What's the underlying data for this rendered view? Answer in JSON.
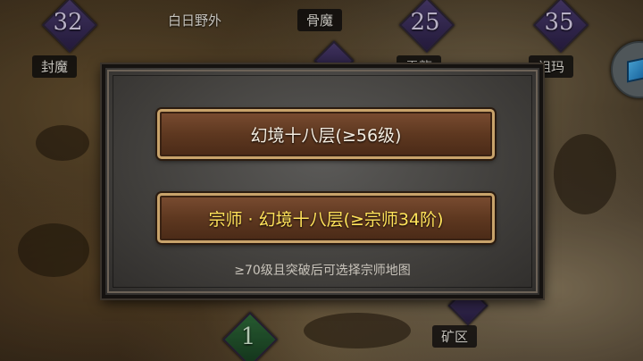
{
  "map": {
    "nodes": [
      {
        "id": "node-32",
        "number": "32"
      },
      {
        "id": "node-25",
        "number": "25"
      },
      {
        "id": "node-35",
        "number": "35"
      },
      {
        "id": "node-1",
        "number": "1"
      }
    ],
    "labels": {
      "fengmo": "封魔",
      "bairi": "白日野外",
      "gumo": "骨魔",
      "partial_mid": "雷龍",
      "zuma": "祖玛",
      "kuangqu": "矿区"
    }
  },
  "dialog": {
    "option_normal": "幻境十八层(≥56级)",
    "option_master": "宗师 · 幻境十八层(≥宗师34阶)",
    "hint": "≥70级且突破后可选择宗师地图"
  },
  "colors": {
    "master_text": "#ffe25a",
    "normal_text": "#f3ece0",
    "button_border": "#c8a36b"
  },
  "icons": {
    "side_button": "cube-icon"
  }
}
